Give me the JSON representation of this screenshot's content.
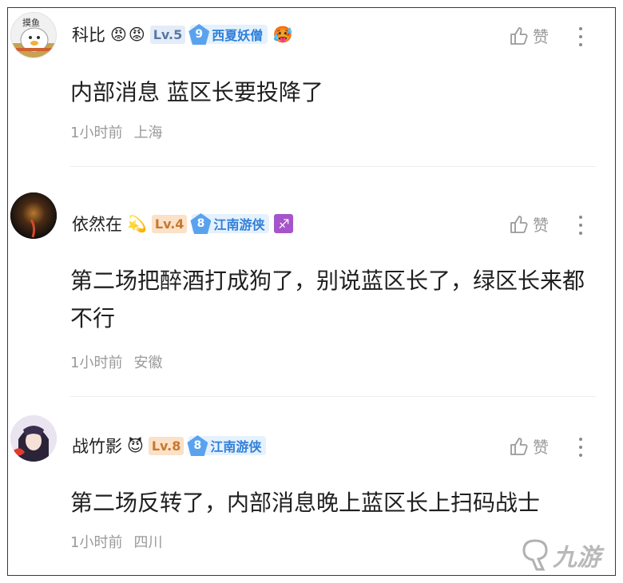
{
  "comments": [
    {
      "username": "科比",
      "emojis": [
        "😡",
        "😡"
      ],
      "level": "Lv.5",
      "fan_num": "9",
      "fan_name": "西夏妖僧",
      "extra_icon": "🥵",
      "like_label": "赞",
      "text": "内部消息 蓝区长要投降了",
      "time": "1小时前",
      "location": "上海",
      "avatar_text": "摸鱼"
    },
    {
      "username": "依然在",
      "emojis": [
        "💫"
      ],
      "level": "Lv.4",
      "fan_num": "8",
      "fan_name": "江南游侠",
      "extra_icon": "♐",
      "like_label": "赞",
      "text": "第二场把醉酒打成狗了，别说蓝区长了，绿区长来都不行",
      "time": "1小时前",
      "location": "安徽"
    },
    {
      "username": "战竹影",
      "emojis": [
        "😈"
      ],
      "level": "Lv.8",
      "fan_num": "8",
      "fan_name": "江南游侠",
      "like_label": "赞",
      "text": "第二场反转了，内部消息晚上蓝区长上扫码战士",
      "time": "1小时前",
      "location": "四川"
    }
  ],
  "watermark": "九游"
}
